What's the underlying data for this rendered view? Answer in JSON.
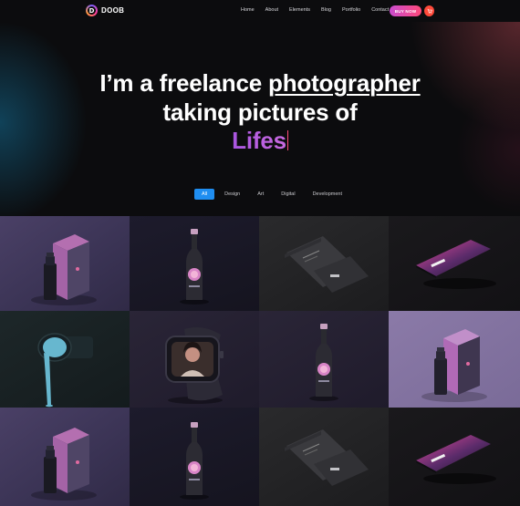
{
  "brand": {
    "name": "DOOB",
    "logo_letter": "D"
  },
  "nav": {
    "items": [
      "Home",
      "About",
      "Elements",
      "Blog",
      "Portfolio",
      "Contact"
    ],
    "buy_label": "BUY NOW"
  },
  "hero": {
    "line1_prefix": "I’m a freelance ",
    "line1_highlight": "photographer",
    "line2": "taking pictures of",
    "typed": "Lifes"
  },
  "filters": [
    "All",
    "Design",
    "Art",
    "Digital",
    "Development"
  ],
  "active_filter": "All",
  "colors": {
    "accent_blue": "#1f8ef1",
    "button_gradient_start": "#c94ccf",
    "button_gradient_end": "#ff4a7a",
    "cart": "#ff4a3a",
    "typed_gradient": "#a955e0"
  },
  "icons": {
    "cart": "cart-icon"
  },
  "portfolio": [
    "cosmetic-box-mockup",
    "wine-bottle-mockup",
    "business-card-mockup",
    "phone-mockup",
    "paint-can-mockup",
    "smartwatch-mockup",
    "wine-bottle-mockup",
    "cosmetic-box-mockup",
    "cosmetic-box-mockup",
    "wine-bottle-mockup",
    "business-card-mockup",
    "phone-mockup"
  ]
}
